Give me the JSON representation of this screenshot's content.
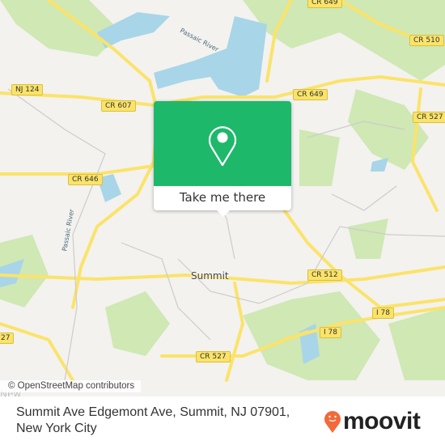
{
  "map": {
    "road_labels": [
      "CR 649",
      "CR 510",
      "NJ 124",
      "CR 607",
      "CR 649",
      "CR 527",
      "CR 646",
      "CR 512",
      "I 78",
      "I 78",
      "CR 527",
      "27"
    ],
    "place_labels": [
      "Summit",
      "New"
    ],
    "river_labels": [
      "Passaic River",
      "Passaic River"
    ],
    "attribution": "© OpenStreetMap contributors",
    "colors": {
      "water": "#a8d5e8",
      "park": "#cfe8b4",
      "road": "#fbe36a",
      "background": "#f3f2ef"
    }
  },
  "popup": {
    "button_label": "Take me there",
    "icon": "map-pin-icon",
    "color": "#1eb86a"
  },
  "footer": {
    "address": "Summit Ave Edgemont Ave, Summit, NJ 07901, New York City",
    "brand": "moovit",
    "brand_color": "#f26a3a"
  }
}
